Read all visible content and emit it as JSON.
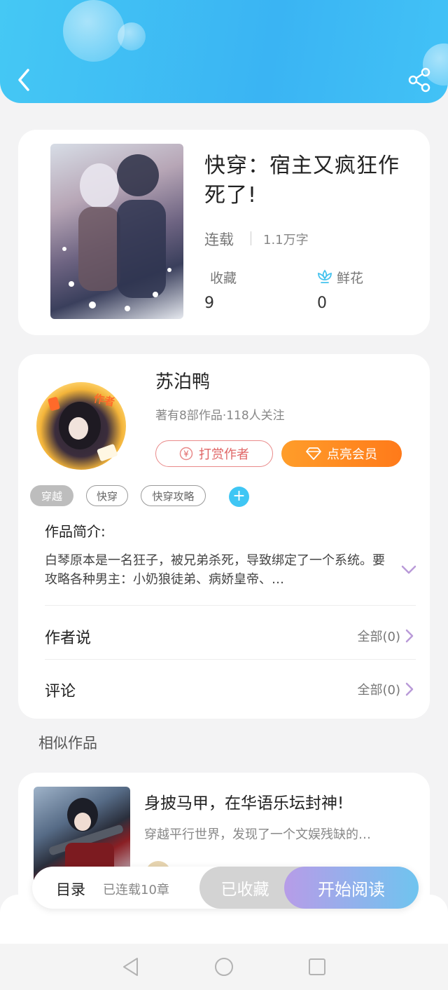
{
  "colors": {
    "header": "#3ab4f3",
    "accent": "#3fc6f4",
    "reward": "#e06666",
    "vip": "#ff8a20",
    "read_start": "#b79ce8",
    "read_end": "#6fc4ef"
  },
  "header": {
    "back_icon": "chevron-left-icon",
    "share_icon": "share-icon"
  },
  "book": {
    "title": "快穿：宿主又疯狂作死了!",
    "status": "连载",
    "word_count": "1.1万字",
    "favorites_label": "收藏",
    "favorites_value": "9",
    "flowers_label": "鲜花",
    "flowers_value": "0",
    "flower_icon": "flower-icon"
  },
  "author": {
    "name": "苏泊鸭",
    "meta": "著有8部作品·118人关注",
    "badge_text": "作者",
    "reward_label": "打赏作者",
    "reward_icon": "yen-icon",
    "vip_label": "点亮会员",
    "vip_icon": "diamond-icon"
  },
  "tags": [
    {
      "label": "穿越",
      "selected": true
    },
    {
      "label": "快穿",
      "selected": false
    },
    {
      "label": "快穿攻略",
      "selected": false
    }
  ],
  "tag_add_label": "+",
  "intro": {
    "title": "作品简介:",
    "text": "白琴原本是一名狂子，被兄弟杀死，导致绑定了一个系统。要攻略各种男主：小奶狼徒弟、病娇皇帝、…"
  },
  "rows": [
    {
      "title": "作者说",
      "more": "全部(0)"
    },
    {
      "title": "评论",
      "more": "全部(0)"
    }
  ],
  "similar": {
    "section_title": "相似作品",
    "title": "身披马甲，在华语乐坛封神!",
    "desc": "穿越平行世界，发现了一个文娱残缺的…"
  },
  "action_bar": {
    "toc_label": "目录",
    "toc_status": "已连载10章",
    "collected_label": "已收藏",
    "read_label": "开始阅读"
  },
  "navbar": {
    "back": "triangle-back-icon",
    "home": "circle-home-icon",
    "recent": "square-recent-icon"
  }
}
